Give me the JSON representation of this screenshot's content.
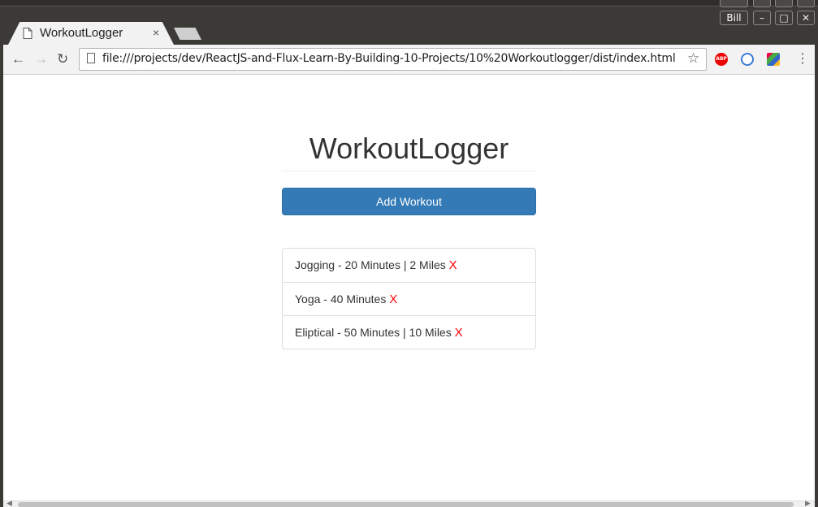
{
  "window": {
    "user_label": "Bill",
    "ghost_user_label": "Bill",
    "minimize_symbol": "–",
    "maximize_symbol": "□",
    "close_symbol": "✕"
  },
  "browser": {
    "tab_title": "WorkoutLogger",
    "tab_close_symbol": "×",
    "url": "file:///projects/dev/ReactJS-and-Flux-Learn-By-Building-10-Projects/10%20Workoutlogger/dist/index.html",
    "back_symbol": "←",
    "forward_symbol": "→",
    "reload_symbol": "↻",
    "star_symbol": "☆",
    "menu_symbol": "⋮",
    "extensions": [
      {
        "name": "adblock-plus",
        "text": "ABP"
      },
      {
        "name": "sync-extension",
        "text": ""
      },
      {
        "name": "color-extension",
        "text": ""
      }
    ]
  },
  "app": {
    "title": "WorkoutLogger",
    "add_button_label": "Add Workout",
    "delete_label": "X",
    "workouts": [
      {
        "text": "Jogging - 20 Minutes | 2 Miles"
      },
      {
        "text": "Yoga - 40 Minutes"
      },
      {
        "text": "Eliptical - 50 Minutes | 10 Miles"
      }
    ]
  },
  "colors": {
    "primary_button": "#337ab7",
    "delete_x": "#ff0000",
    "window_frame": "#3b3a36"
  }
}
